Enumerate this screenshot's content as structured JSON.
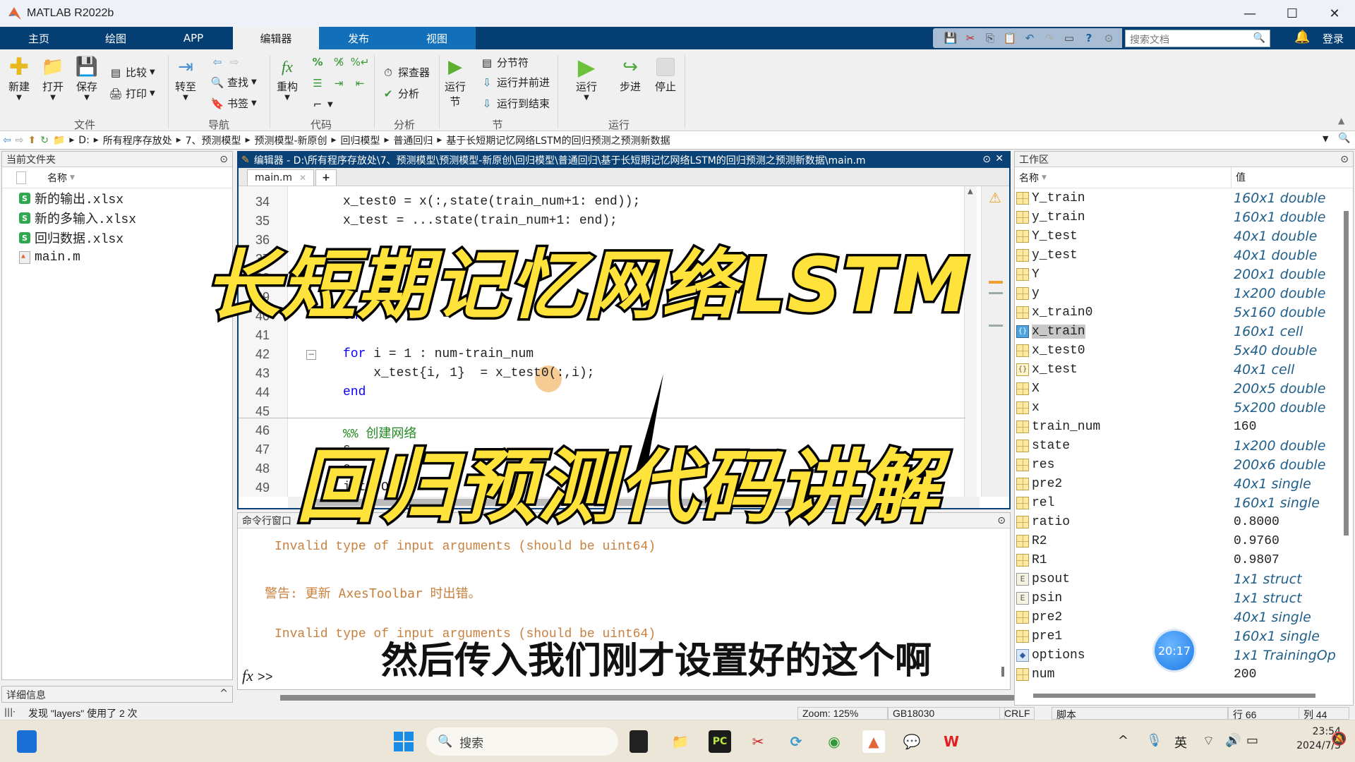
{
  "window": {
    "title": "MATLAB R2022b",
    "controls": {
      "minimize": "—",
      "maximize": "☐",
      "close": "✕"
    }
  },
  "ribbon_tabs": [
    {
      "label": "主页"
    },
    {
      "label": "绘图"
    },
    {
      "label": "APP"
    },
    {
      "label": "编辑器",
      "active": true
    },
    {
      "label": "发布"
    },
    {
      "label": "视图"
    }
  ],
  "quick_access": {
    "icons": [
      "save-icon",
      "cut-icon",
      "copy-icon",
      "paste-icon",
      "undo-icon",
      "redo-icon",
      "switch-windows-icon",
      "help-icon",
      "dropdown-icon"
    ],
    "search_placeholder": "搜索文档",
    "login": "登录"
  },
  "toolstrip": {
    "file": {
      "new": "新建",
      "open": "打开",
      "save": "保存",
      "compare": "比较",
      "print": "打印",
      "group": "文件"
    },
    "navigate": {
      "goto": "转至",
      "find": "查找",
      "bookmark": "书签",
      "group": "导航"
    },
    "code": {
      "refactor": "重构",
      "group": "代码"
    },
    "analyze": {
      "profiler": "探查器",
      "analyze": "分析",
      "group": "分析"
    },
    "section": {
      "run_section": "运行",
      "run_section2": "节",
      "section_break": "分节符",
      "run_advance": "运行并前进",
      "run_to_end": "运行到结束",
      "group": "节"
    },
    "run": {
      "run": "运行",
      "step": "步进",
      "stop": "停止",
      "group": "运行"
    }
  },
  "address_bar": {
    "crumbs": [
      "D:",
      "所有程序存放处",
      "7、预测模型",
      "预测模型-新原创",
      "回归模型",
      "普通回归",
      "基于长短期记忆网络LSTM的回归预测之预测新数据"
    ]
  },
  "current_folder": {
    "title": "当前文件夹",
    "column": "名称",
    "files": [
      {
        "name": "新的输出.xlsx",
        "type": "xlsx"
      },
      {
        "name": "新的多输入.xlsx",
        "type": "xlsx"
      },
      {
        "name": "回归数据.xlsx",
        "type": "xlsx"
      },
      {
        "name": "main.m",
        "type": "m"
      }
    ],
    "details": "详细信息"
  },
  "editor": {
    "title": "编辑器 - D:\\所有程序存放处\\7、预测模型\\预测模型-新原创\\回归模型\\普通回归\\基于长短期记忆网络LSTM的回归预测之预测新数据\\main.m",
    "tab": "main.m",
    "lines": [
      {
        "n": "34",
        "code": "x_test0 = x(:,state(train_num+1: end));"
      },
      {
        "n": "35",
        "code": "x_test = ...state(train_num+1: end);"
      },
      {
        "n": "36",
        "code": ""
      },
      {
        "n": "37",
        "code": ""
      },
      {
        "n": "38",
        "code": ""
      },
      {
        "n": "39",
        "code": ""
      },
      {
        "n": "40",
        "code": "end"
      },
      {
        "n": "41",
        "code": ""
      },
      {
        "n": "42",
        "code": "for i = 1 : num-train_num"
      },
      {
        "n": "43",
        "code": "    x_test{i, 1}  = x_test0(:,i);"
      },
      {
        "n": "44",
        "code": "end"
      },
      {
        "n": "45",
        "code": ""
      },
      {
        "n": "46",
        "code": "%% 创建网络"
      },
      {
        "n": "47",
        "code": "s"
      },
      {
        "n": "48",
        "code": "e"
      },
      {
        "n": "49",
        "code": "ist 'O"
      }
    ]
  },
  "command_window": {
    "title": "命令行窗口",
    "lines": [
      "Invalid type of input arguments (should be uint64)",
      "警告: 更新 AxesToolbar 时出错。",
      "Invalid type of input arguments (should be uint64)"
    ],
    "prompt": "fx",
    "prompt_symbol": ">>"
  },
  "workspace": {
    "title": "工作区",
    "columns": [
      "名称",
      "值"
    ],
    "vars": [
      {
        "name": "Y_train",
        "value": "160x1 double",
        "icon": "matrix"
      },
      {
        "name": "y_train",
        "value": "160x1 double",
        "icon": "matrix"
      },
      {
        "name": "Y_test",
        "value": "40x1 double",
        "icon": "matrix"
      },
      {
        "name": "y_test",
        "value": "40x1 double",
        "icon": "matrix"
      },
      {
        "name": "Y",
        "value": "200x1 double",
        "icon": "matrix"
      },
      {
        "name": "y",
        "value": "1x200 double",
        "icon": "matrix"
      },
      {
        "name": "x_train0",
        "value": "5x160 double",
        "icon": "matrix"
      },
      {
        "name": "x_train",
        "value": "160x1 cell",
        "icon": "cell",
        "selected": true
      },
      {
        "name": "x_test0",
        "value": "5x40 double",
        "icon": "matrix"
      },
      {
        "name": "x_test",
        "value": "40x1 cell",
        "icon": "cell2"
      },
      {
        "name": "X",
        "value": "200x5 double",
        "icon": "matrix"
      },
      {
        "name": "x",
        "value": "5x200 double",
        "icon": "matrix"
      },
      {
        "name": "train_num",
        "value": "160",
        "icon": "matrix",
        "numeric": true
      },
      {
        "name": "state",
        "value": "1x200 double",
        "icon": "matrix"
      },
      {
        "name": "res",
        "value": "200x6 double",
        "icon": "matrix"
      },
      {
        "name": "pre2",
        "value": "40x1 single",
        "icon": "matrix"
      },
      {
        "name": "rel",
        "value": "160x1 single",
        "icon": "matrix"
      },
      {
        "name": "ratio",
        "value": "0.8000",
        "icon": "matrix",
        "numeric": true
      },
      {
        "name": "R2",
        "value": "0.9760",
        "icon": "matrix",
        "numeric": true
      },
      {
        "name": "R1",
        "value": "0.9807",
        "icon": "matrix",
        "numeric": true
      },
      {
        "name": "psout",
        "value": "1x1 struct",
        "icon": "struct"
      },
      {
        "name": "psin",
        "value": "1x1 struct",
        "icon": "struct"
      },
      {
        "name": "pre2",
        "value": "40x1 single",
        "icon": "matrix"
      },
      {
        "name": "pre1",
        "value": "160x1 single",
        "icon": "matrix"
      },
      {
        "name": "options",
        "value": "1x1 TrainingOp",
        "icon": "object"
      },
      {
        "name": "num",
        "value": "200",
        "icon": "matrix",
        "numeric": true
      }
    ]
  },
  "status_bar": {
    "message": "发现 \"layers\" 使用了 2 次",
    "zoom": "Zoom: 125%",
    "encoding": "GB18030",
    "eol": "CRLF",
    "type": "脚本",
    "row_label": "行",
    "row": "66",
    "col_label": "列",
    "col": "44"
  },
  "taskbar": {
    "search": "搜索",
    "ime": "英",
    "time": "23:54",
    "date": "2024/7/5"
  },
  "overlay": {
    "caption_line1": "长短期记忆网络LSTM",
    "caption_line2": "回归预测代码讲解",
    "subtitle": "然后传入我们刚才设置好的这个啊",
    "timer": "20:17"
  },
  "colors": {
    "ribbon_dark": "#043e72",
    "ribbon_blue": "#1170b9",
    "editor_frame": "#0a4276",
    "keyword": "#0e00ff",
    "warning_text": "#c8803e",
    "workspace_value": "#1f5f8a",
    "caption_yellow": "#ffe23a"
  }
}
